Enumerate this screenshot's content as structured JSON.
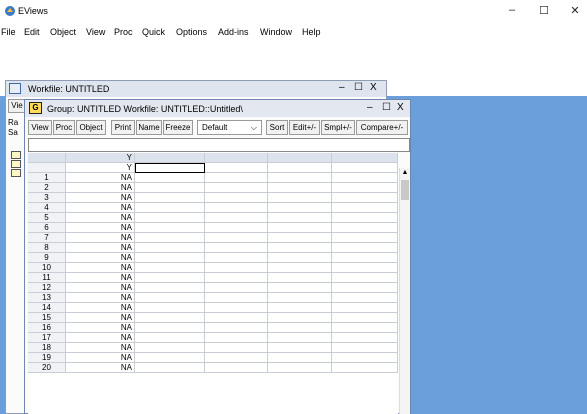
{
  "app": {
    "title": "EViews",
    "minimize": "–",
    "maximize": "☐",
    "close": "✕"
  },
  "menu": [
    "File",
    "Edit",
    "Object",
    "View",
    "Proc",
    "Quick",
    "Options",
    "Add-ins",
    "Window",
    "Help"
  ],
  "workfile": {
    "title": "Workfile: UNTITLED",
    "view_btn": "Vie",
    "range_label": "Ra",
    "sample_label": "Sa",
    "minimize": "–",
    "maximize": "☐",
    "close": "X"
  },
  "group": {
    "icon": "G",
    "title": "Group: UNTITLED   Workfile: UNTITLED::Untitled\\",
    "minimize": "–",
    "maximize": "☐",
    "close": "X",
    "toolbar": {
      "view": "View",
      "proc": "Proc",
      "object": "Object",
      "print": "Print",
      "name": "Name",
      "freeze": "Freeze",
      "display": "Default",
      "sort": "Sort",
      "edit": "Edit+/-",
      "smpl": "Smpl+/-",
      "compare": "Compare+/-"
    },
    "header": {
      "col1": "Y",
      "col1b": "Y"
    },
    "rows": [
      {
        "n": "1",
        "v": "NA"
      },
      {
        "n": "2",
        "v": "NA"
      },
      {
        "n": "3",
        "v": "NA"
      },
      {
        "n": "4",
        "v": "NA"
      },
      {
        "n": "5",
        "v": "NA"
      },
      {
        "n": "6",
        "v": "NA"
      },
      {
        "n": "7",
        "v": "NA"
      },
      {
        "n": "8",
        "v": "NA"
      },
      {
        "n": "9",
        "v": "NA"
      },
      {
        "n": "10",
        "v": "NA"
      },
      {
        "n": "11",
        "v": "NA"
      },
      {
        "n": "12",
        "v": "NA"
      },
      {
        "n": "13",
        "v": "NA"
      },
      {
        "n": "14",
        "v": "NA"
      },
      {
        "n": "15",
        "v": "NA"
      },
      {
        "n": "16",
        "v": "NA"
      },
      {
        "n": "17",
        "v": "NA"
      },
      {
        "n": "18",
        "v": "NA"
      },
      {
        "n": "19",
        "v": "NA"
      },
      {
        "n": "20",
        "v": "NA"
      }
    ]
  },
  "colors": {
    "desktop": "#6a9fdc",
    "header_bg": "#dde3ec",
    "grid": "#c8cdd6"
  }
}
